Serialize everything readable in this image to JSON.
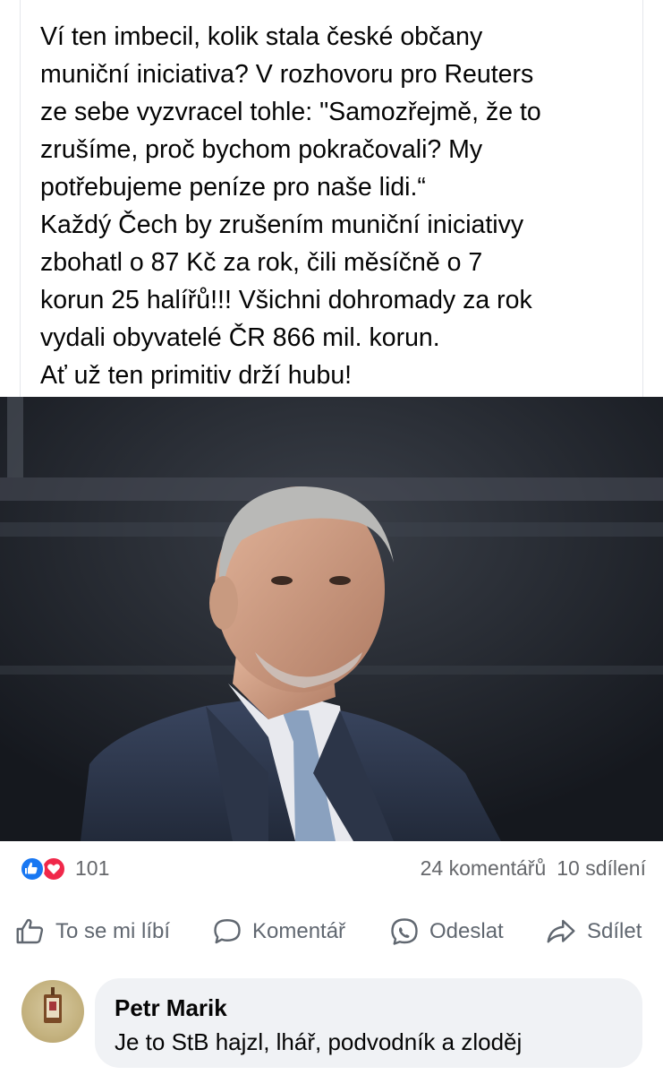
{
  "post": {
    "text_lines": [
      "Ví ten imbecil, kolik stala české občany",
      "muniční iniciativa? V rozhovoru pro Reuters",
      "ze sebe vyzvracel tohle: \"Samozřejmě, že to",
      "zrušíme, proč bychom pokračovali? My",
      "potřebujeme peníze pro naše lidi.“",
      "Každý Čech by zrušením muniční iniciativy",
      "zbohatl o 87 Kč za rok, čili měsíčně o 7",
      "korun 25 halířů!!! Všichni dohromady za rok",
      "vydali obyvatelé ČR 866 mil. korun.",
      "Ať už ten primitiv drží hubu!"
    ]
  },
  "stats": {
    "reactions_count": "101",
    "comments": "24 komentářů",
    "shares": "10 sdílení"
  },
  "actions": {
    "like": "To se mi líbí",
    "comment": "Komentář",
    "send": "Odeslat",
    "share": "Sdílet"
  },
  "comment": {
    "author": "Petr Marik",
    "text": "Je to StB hajzl, lhář, podvodník a zloděj"
  },
  "colors": {
    "like_blue": "#1877f2",
    "love_red": "#f0284a",
    "muted_text": "#65676b",
    "bubble_bg": "#f0f2f5"
  },
  "icons": [
    "like-reaction-icon",
    "love-reaction-icon",
    "thumbs-up-icon",
    "comment-icon",
    "messenger-icon",
    "share-icon"
  ]
}
